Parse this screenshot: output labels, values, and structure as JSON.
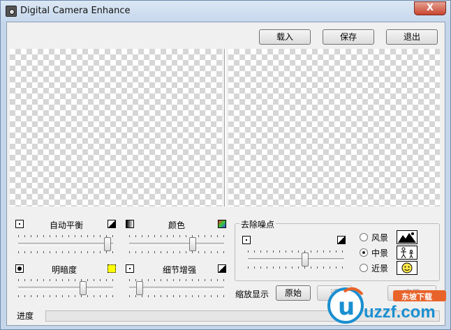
{
  "window": {
    "title": "Digital Camera Enhance",
    "close_label": "X"
  },
  "toolbar": {
    "load_label": "载入",
    "save_label": "保存",
    "exit_label": "退出"
  },
  "adjust": {
    "auto_balance": {
      "label": "自动平衡",
      "value": 0.98
    },
    "color": {
      "label": "颜色",
      "value": 0.68
    },
    "brightness": {
      "label": "明暗度",
      "value": 0.7
    },
    "detail": {
      "label": "细节增强",
      "value": 0.08
    }
  },
  "denoise": {
    "title": "去除噪点",
    "value": 0.6,
    "options": [
      {
        "label": "风景",
        "icon": "landscape-icon",
        "checked": false
      },
      {
        "label": "中景",
        "icon": "people-icon",
        "checked": true
      },
      {
        "label": "近景",
        "icon": "face-icon",
        "checked": false
      }
    ]
  },
  "zoom": {
    "label": "缩放显示",
    "original_label": "原始",
    "fit_label": "适",
    "apply_label": "应用"
  },
  "progress": {
    "label": "进度",
    "value": 0.0
  },
  "watermark": {
    "brand": "uzzf.com",
    "tag": "东坡下载"
  },
  "colors": {
    "accent_green": "#3a9d3a",
    "watermark_blue": "#1a8fd0",
    "watermark_orange": "#e8632a"
  }
}
